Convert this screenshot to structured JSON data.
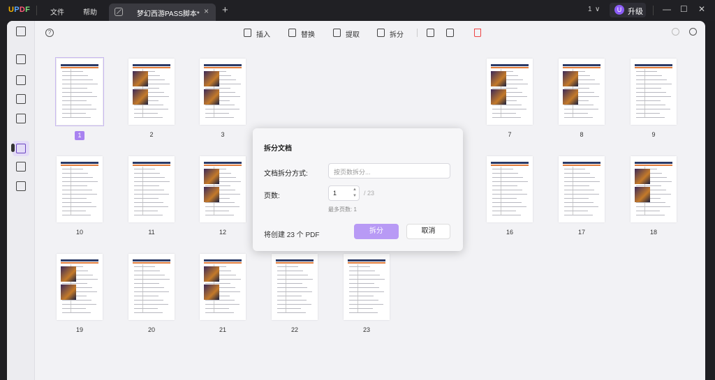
{
  "titlebar": {
    "logo": {
      "u": "U",
      "p": "P",
      "d": "D",
      "f": "F"
    },
    "menus": [
      "文件",
      "帮助"
    ],
    "tab_title": "梦幻西游PASS脚本*",
    "tab_close": "×",
    "new_tab": "+",
    "page_indicator": "1",
    "page_dropdown": "∨",
    "avatar_letter": "U",
    "upgrade_label": "升级",
    "minimize": "—",
    "maximize": "☐",
    "close": "✕"
  },
  "toolbar": {
    "help": "?",
    "insert": "插入",
    "replace": "替换",
    "extract": "提取",
    "split": "拆分"
  },
  "pages": [
    {
      "label": "1",
      "selected": true
    },
    {
      "label": "2"
    },
    {
      "label": "3"
    },
    {
      "label": "7"
    },
    {
      "label": "8"
    },
    {
      "label": "9"
    },
    {
      "label": "10"
    },
    {
      "label": "11"
    },
    {
      "label": "12"
    },
    {
      "label": "16"
    },
    {
      "label": "17"
    },
    {
      "label": "18"
    },
    {
      "label": "19"
    },
    {
      "label": "20"
    },
    {
      "label": "21"
    },
    {
      "label": "22"
    },
    {
      "label": "23"
    }
  ],
  "dialog": {
    "title": "拆分文档",
    "method_label": "文档拆分方式:",
    "method_placeholder": "按页数拆分...",
    "pages_label": "页数:",
    "pages_value": "1",
    "pages_total": "/ 23",
    "max_hint": "最多页数: 1",
    "info": "将创建 23 个 PDF",
    "split_button": "拆分",
    "cancel_button": "取消"
  },
  "colors": {
    "accent": "#b89af5",
    "selected": "#a882f0",
    "delete": "#e44444"
  }
}
